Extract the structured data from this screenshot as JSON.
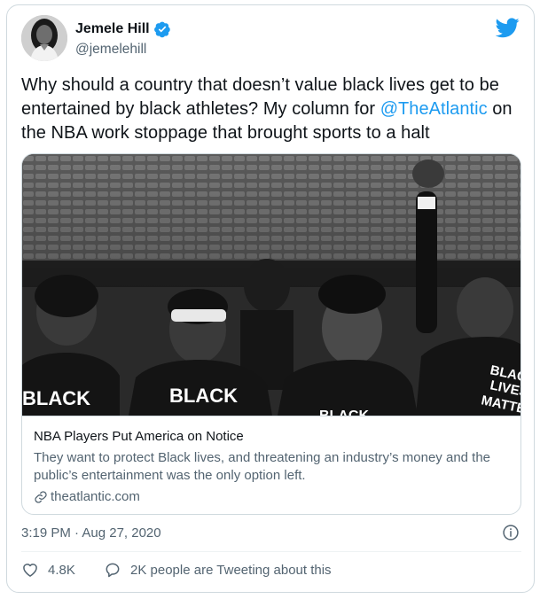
{
  "author": {
    "display_name": "Jemele Hill",
    "handle": "@jemelehill",
    "verified": true
  },
  "tweet": {
    "text_before": "Why should a country that doesn’t value black lives get to be entertained by black athletes? My column for ",
    "mention": "@TheAtlantic",
    "text_after": " on the NBA work stoppage that brought sports to a halt",
    "timestamp": "3:19 PM · Aug 27, 2020"
  },
  "link_card": {
    "title": "NBA Players Put America on Notice",
    "description": "They want to protect Black lives, and threatening an industry’s money and the public’s entertainment was the only option left.",
    "domain": "theatlantic.com",
    "image_shirt_text": [
      "BLACK",
      "LIVES",
      "MATTER"
    ]
  },
  "actions": {
    "likes": "4.8K",
    "tweeting_about": "2K people are Tweeting about this"
  },
  "colors": {
    "accent": "#1d9bf0",
    "text_primary": "#0f1419",
    "text_secondary": "#536471",
    "border": "#cfd9de"
  },
  "icons": [
    "twitter-bird-icon",
    "verified-badge-icon",
    "link-icon",
    "info-icon",
    "heart-icon",
    "speech-bubble-icon"
  ]
}
